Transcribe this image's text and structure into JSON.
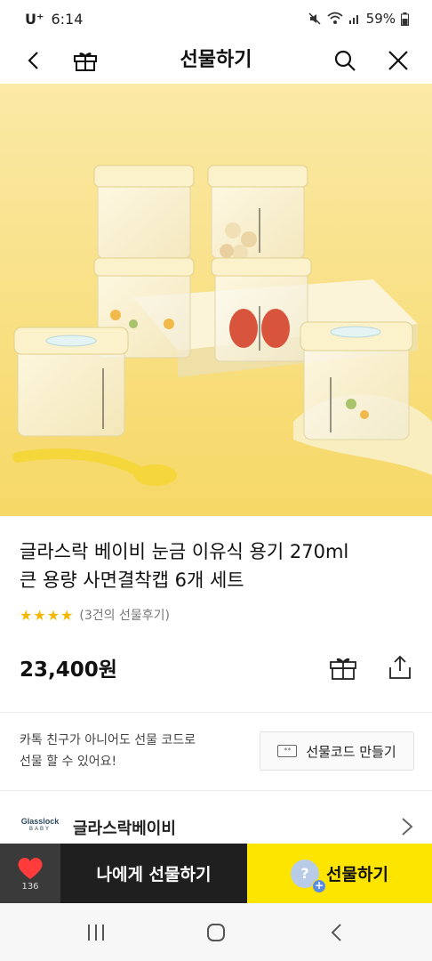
{
  "status_bar": {
    "carrier": "U⁺",
    "time": "6:14",
    "battery": "59%"
  },
  "header": {
    "title": "선물하기"
  },
  "product": {
    "title_line1": "글라스락 베이비 눈금 이유식 용기 270ml",
    "title_line2": "큰 용량 사면결착캡 6개 세트",
    "stars": "★★★★",
    "review_text": "(3건의 선물후기)",
    "price": "23,400원"
  },
  "gift_code": {
    "message_line1": "카톡 친구가 아니어도 선물 코드로",
    "message_line2": "선물 할 수 있어요!",
    "button_label": "선물코드 만들기",
    "badge_text": "**"
  },
  "brand": {
    "logo_line1": "Glasslock",
    "logo_line2": "BABY",
    "name": "글라스락베이비"
  },
  "bottom_bar": {
    "wish_count": "136",
    "gift_self_label": "나에게 선물하기",
    "gift_label": "선물하기",
    "avatar_glyph": "?",
    "plus_glyph": "+"
  },
  "colors": {
    "accent_yellow": "#fee500",
    "dark": "#1f1f1f",
    "heart": "#ff3b3b",
    "star": "#f5b800"
  },
  "icons": [
    "back-icon",
    "gift-icon",
    "search-icon",
    "close-icon",
    "share-icon",
    "heart-icon",
    "chevron-right-icon",
    "recents-icon",
    "home-icon",
    "nav-back-icon"
  ]
}
